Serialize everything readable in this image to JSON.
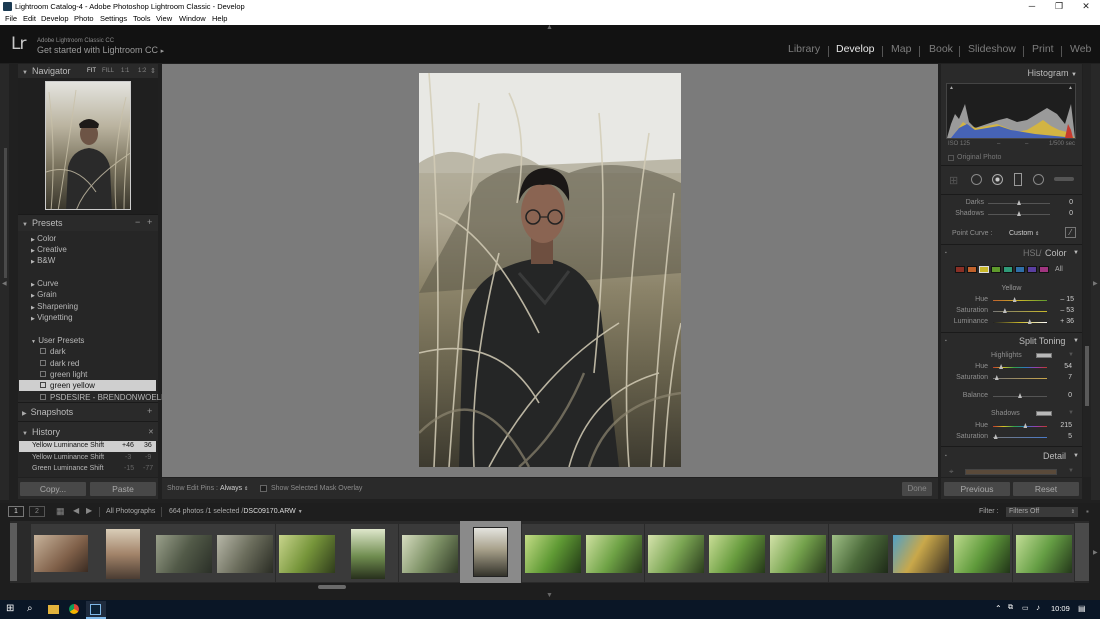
{
  "window": {
    "title": "Lightroom Catalog-4 - Adobe Photoshop Lightroom Classic - Develop",
    "controls": {
      "minimize": "─",
      "maximize": "❐",
      "close": "✕"
    }
  },
  "menu": [
    "File",
    "Edit",
    "Develop",
    "Photo",
    "Settings",
    "Tools",
    "View",
    "Window",
    "Help"
  ],
  "identity": {
    "logo": "Lr",
    "product": "Adobe Lightroom Classic CC",
    "tagline": "Get started with Lightroom CC",
    "tagline_arrow": "▸"
  },
  "modules": [
    "Library",
    "Develop",
    "Map",
    "Book",
    "Slideshow",
    "Print",
    "Web"
  ],
  "active_module": "Develop",
  "navigator": {
    "title": "Navigator",
    "zoom": [
      "FIT",
      "FILL",
      "1:1",
      "1:2"
    ],
    "zoom_more": "⇕"
  },
  "presets": {
    "title": "Presets",
    "groups": [
      "Color",
      "Creative",
      "B&W",
      "Curve",
      "Grain",
      "Sharpening",
      "Vignetting"
    ],
    "user_group": "User Presets",
    "user_items": [
      "dark",
      "dark red",
      "green light",
      "green yellow",
      "PSDESIRE - BRENDONWOELFEL..."
    ],
    "selected": "green yellow",
    "minus": "−",
    "plus": "+"
  },
  "snapshots": {
    "title": "Snapshots",
    "plus": "+"
  },
  "history": {
    "title": "History",
    "close": "✕",
    "rows": [
      {
        "name": "Yellow Luminance Shift",
        "delta": "+46",
        "value": "36"
      },
      {
        "name": "Yellow Luminance Shift",
        "delta": "-3",
        "value": "-9"
      },
      {
        "name": "Green Luminance Shift",
        "delta": "-15",
        "value": "-77"
      }
    ]
  },
  "left_buttons": {
    "copy": "Copy...",
    "paste": "Paste"
  },
  "center_toolbar": {
    "edit_pins_label": "Show Edit Pins :",
    "edit_pins_value": "Always",
    "mask_overlay": "Show Selected Mask Overlay",
    "done": "Done"
  },
  "histogram": {
    "title": "Histogram",
    "info": [
      "ISO 125",
      "–",
      "–",
      "1/500 sec"
    ],
    "original_photo": "Original Photo"
  },
  "tone": {
    "darks": {
      "label": "Darks",
      "value": "0",
      "pos": 0.5
    },
    "shadows": {
      "label": "Shadows",
      "value": "0",
      "pos": 0.5
    },
    "point_curve_label": "Point Curve :",
    "point_curve_value": "Custom"
  },
  "hsl": {
    "title_hsl": "HSL",
    "title_color": "Color",
    "swatches": [
      "#8a2f25",
      "#c0622c",
      "#c9b82a",
      "#5e9a2c",
      "#2f9a78",
      "#2f6fa8",
      "#5a3fa0",
      "#a0357f"
    ],
    "all": "All",
    "channel": "Yellow",
    "rows": [
      {
        "label": "Hue",
        "value": "– 15",
        "pos": 0.4
      },
      {
        "label": "Saturation",
        "value": "– 53",
        "pos": 0.22
      },
      {
        "label": "Luminance",
        "value": "+ 36",
        "pos": 0.68
      }
    ]
  },
  "split_toning": {
    "title": "Split Toning",
    "highlights_label": "Highlights",
    "highlights": [
      {
        "label": "Hue",
        "value": "54",
        "pos": 0.15
      },
      {
        "label": "Saturation",
        "value": "7",
        "pos": 0.07
      }
    ],
    "balance": {
      "label": "Balance",
      "value": "0",
      "pos": 0.5
    },
    "shadows_label": "Shadows",
    "shadows": [
      {
        "label": "Hue",
        "value": "215",
        "pos": 0.6
      },
      {
        "label": "Saturation",
        "value": "5",
        "pos": 0.05
      }
    ]
  },
  "detail": {
    "title": "Detail"
  },
  "right_buttons": {
    "previous": "Previous",
    "reset": "Reset"
  },
  "filmstrip": {
    "views": [
      "1",
      "2"
    ],
    "source": "All Photographs",
    "count": "664 photos /1 selected /",
    "filename": "DSC09170.ARW",
    "filter_label": "Filter :",
    "filter_value": "Filters Off"
  },
  "taskbar": {
    "time": "10:09"
  }
}
